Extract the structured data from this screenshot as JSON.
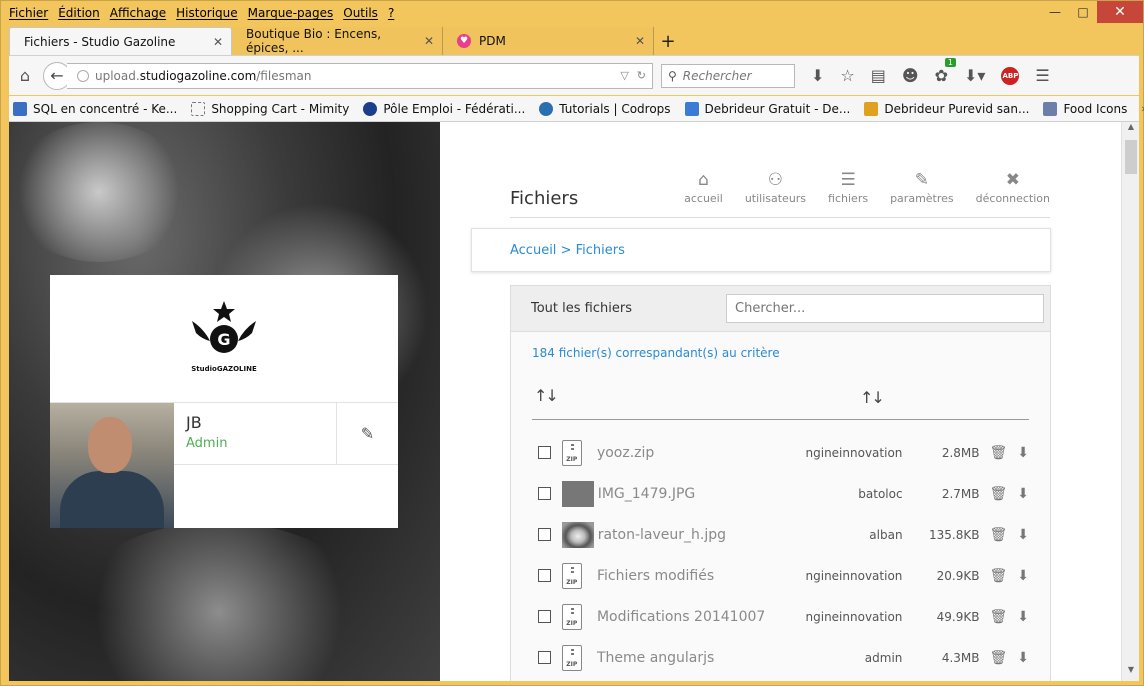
{
  "menu": [
    "Fichier",
    "Édition",
    "Affichage",
    "Historique",
    "Marque-pages",
    "Outils",
    "?"
  ],
  "tabs": [
    {
      "label": "Fichiers - Studio Gazoline",
      "active": true
    },
    {
      "label": "Boutique Bio : Encens, épices, ...",
      "active": false
    },
    {
      "label": "PDM",
      "active": false
    }
  ],
  "url": {
    "prefix": "upload.",
    "host": "studiogazoline.com",
    "path": "/filesman"
  },
  "search_placeholder": "Rechercher",
  "toolbar_badge": "1",
  "abp_label": "ABP",
  "bookmarks": [
    {
      "label": "SQL en concentré - Ke...",
      "color": "#3b6fc4"
    },
    {
      "label": "Shopping Cart - Mimity",
      "color": "#ffffff"
    },
    {
      "label": "Pôle Emploi - Fédérati...",
      "color": "#1c3f8c"
    },
    {
      "label": "Tutorials | Codrops",
      "color": "#2a6fb0"
    },
    {
      "label": "Debrideur Gratuit - De...",
      "color": "#3a7bd5"
    },
    {
      "label": "Debrideur Purevid san...",
      "color": "#e0a020"
    },
    {
      "label": "Food Icons",
      "color": "#6b7fa8"
    }
  ],
  "card": {
    "logo_text": "StudioGAZOLINE",
    "user_name": "JB",
    "user_role": "Admin"
  },
  "page": {
    "title": "Fichiers",
    "nav": [
      {
        "icon": "home-icon",
        "label": "accueil"
      },
      {
        "icon": "users-icon",
        "label": "utilisateurs"
      },
      {
        "icon": "list-icon",
        "label": "fichiers"
      },
      {
        "icon": "pencil-icon",
        "label": "paramètres"
      },
      {
        "icon": "close-icon",
        "label": "déconnection"
      }
    ],
    "breadcrumb": "Accueil > Fichiers",
    "files_title": "Tout les fichiers",
    "files_search_placeholder": "Chercher...",
    "count_text": "184 fichier(s) correspandant(s) au critère",
    "files": [
      {
        "name": "yooz.zip",
        "owner": "ngineinnovation",
        "size": "2.8MB",
        "type": "zip"
      },
      {
        "name": "IMG_1479.JPG",
        "owner": "batoloc",
        "size": "2.7MB",
        "type": "gray"
      },
      {
        "name": "raton-laveur_h.jpg",
        "owner": "alban",
        "size": "135.8KB",
        "type": "raccoon"
      },
      {
        "name": "Fichiers modifiés",
        "owner": "ngineinnovation",
        "size": "20.9KB",
        "type": "zip"
      },
      {
        "name": "Modifications 20141007",
        "owner": "ngineinnovation",
        "size": "49.9KB",
        "type": "zip"
      },
      {
        "name": "Theme angularjs",
        "owner": "admin",
        "size": "4.3MB",
        "type": "zip"
      }
    ]
  }
}
